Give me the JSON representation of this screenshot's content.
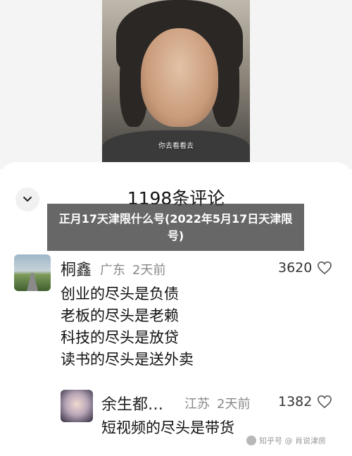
{
  "video": {
    "subtitle": "你去看看去"
  },
  "comments_panel": {
    "count_title": "1198条评论",
    "collapse_icon": "chevron-down-icon"
  },
  "banner": {
    "text": "正月17天津限什么号(2022年5月17日天津限号)"
  },
  "comments": [
    {
      "username": "桐鑫",
      "location": "广东",
      "time": "2天前",
      "likes": "3620",
      "lines": [
        "创业的尽头是负债",
        "老板的尽头是老赖",
        "科技的尽头是放贷",
        "读书的尽头是送外卖"
      ]
    },
    {
      "username": "余生都…",
      "location": "江苏",
      "time": "2天前",
      "likes": "1382",
      "lines": [
        "短视频的尽头是带货"
      ]
    }
  ],
  "watermark": {
    "text": "知乎号 @ 肖说津房"
  },
  "colors": {
    "banner_bg": "#464646",
    "text": "#111111",
    "meta": "#888888"
  }
}
